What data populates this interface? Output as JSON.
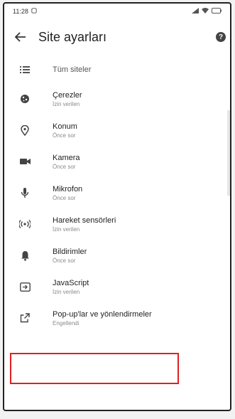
{
  "status_bar": {
    "time": "11:28",
    "icons_right": "signal-wifi-battery"
  },
  "header": {
    "title": "Site ayarları"
  },
  "items": [
    {
      "name": "all-sites",
      "label": "Tüm siteler",
      "sub": ""
    },
    {
      "name": "cookies",
      "label": "Çerezler",
      "sub": "İzin verilen"
    },
    {
      "name": "location",
      "label": "Konum",
      "sub": "Önce sor"
    },
    {
      "name": "camera",
      "label": "Kamera",
      "sub": "Önce sor"
    },
    {
      "name": "microphone",
      "label": "Mikrofon",
      "sub": "Önce sor"
    },
    {
      "name": "motion-sensors",
      "label": "Hareket sensörleri",
      "sub": "İzin verilen"
    },
    {
      "name": "notifications",
      "label": "Bildirimler",
      "sub": "Önce sor"
    },
    {
      "name": "javascript",
      "label": "JavaScript",
      "sub": "İzin verilen"
    },
    {
      "name": "popups",
      "label": "Pop-up'lar ve yönlendirmeler",
      "sub": "Engellendi"
    }
  ],
  "colors": {
    "highlight": "#e02020"
  }
}
